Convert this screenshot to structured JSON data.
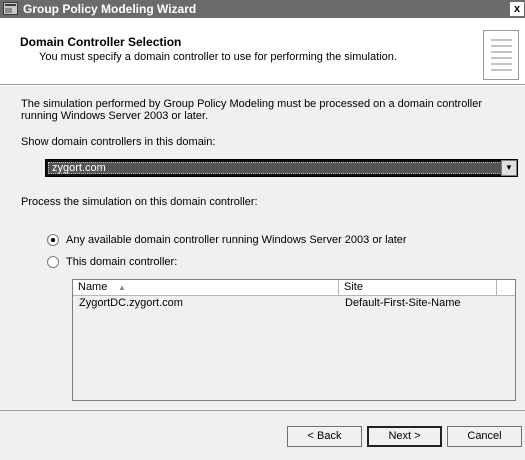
{
  "window": {
    "title": "Group Policy Modeling Wizard",
    "close_label": "x"
  },
  "header": {
    "title": "Domain Controller Selection",
    "subtitle": "You must specify a domain controller to use for performing the simulation."
  },
  "content": {
    "description": "The simulation performed by Group Policy Modeling must be processed on a domain controller running Windows Server 2003 or later.",
    "domain_label": "Show domain controllers in this domain:",
    "domain_value": "zygort.com",
    "process_label": "Process the simulation on this domain controller:",
    "radio_any": {
      "label": "Any available domain controller running Windows Server 2003 or later",
      "checked": true
    },
    "radio_this": {
      "label": "This domain controller:",
      "checked": false
    }
  },
  "listview": {
    "columns": [
      "Name",
      "Site"
    ],
    "sort_icon": "sort-ascending-icon",
    "rows": [
      [
        "ZygortDC.zygort.com",
        "Default-First-Site-Name"
      ]
    ]
  },
  "footer": {
    "back": "< Back",
    "next": "Next >",
    "cancel": "Cancel"
  }
}
